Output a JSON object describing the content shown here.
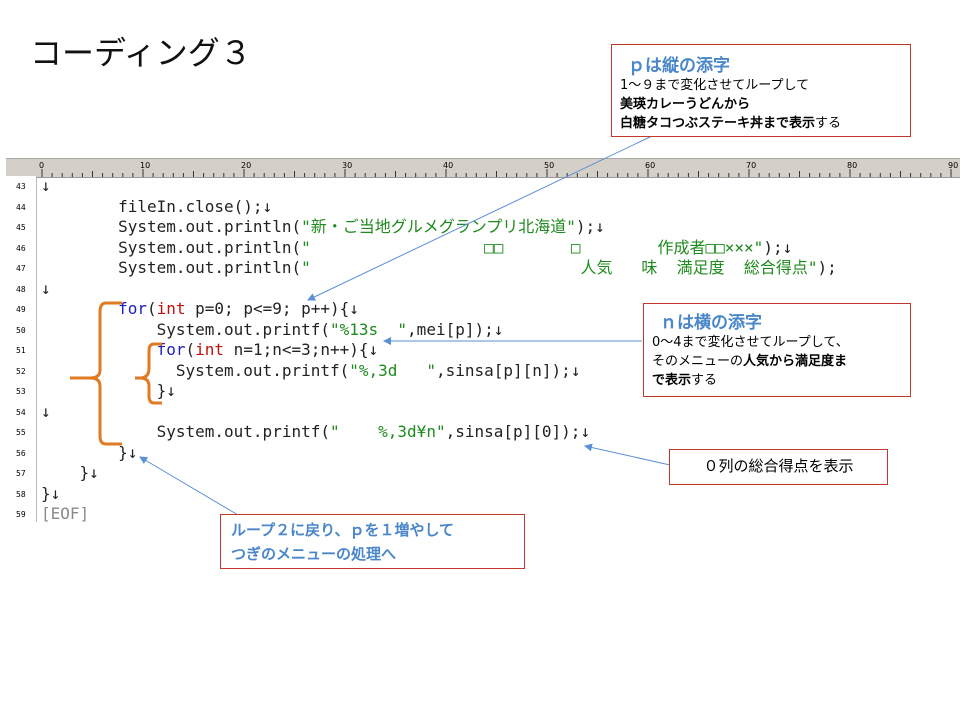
{
  "slide": {
    "title": "コーディング３"
  },
  "ruler": {
    "labels": [
      "0",
      "10",
      "20",
      "30",
      "40",
      "50",
      "60",
      "70",
      "80",
      "90"
    ]
  },
  "lines": [
    {
      "no": "43",
      "text": "↓"
    },
    {
      "no": "44",
      "text": "        fileIn.close();↓"
    },
    {
      "no": "45",
      "pre": "        System.out.println(",
      "str": "\"新・ご当地グルメグランプリ北海道\"",
      "post": ");↓"
    },
    {
      "no": "46",
      "pre": "        System.out.println(",
      "str": "\"                  □□       □        作成者□□×××\"",
      "post": ");↓"
    },
    {
      "no": "47",
      "pre": "        System.out.println(",
      "str": "\"                            人気   味  満足度  総合得点\"",
      "post": ");"
    },
    {
      "no": "48",
      "text": "↓"
    },
    {
      "no": "49",
      "pre": "        ",
      "kw": "for",
      "mid": "(",
      "kw2": "int",
      "post": " p=0; p<=9; p++){↓"
    },
    {
      "no": "50",
      "pre": "            System.out.printf(",
      "str": "\"%13s  \"",
      "post": ",mei[p]);↓"
    },
    {
      "no": "51",
      "pre": "            ",
      "kw": "for",
      "mid": "(",
      "kw2": "int",
      "post": " n=1;n<=3;n++){↓"
    },
    {
      "no": "52",
      "pre": "              System.out.printf(",
      "str": "\"%,3d   \"",
      "post": ",sinsa[p][n]);↓"
    },
    {
      "no": "53",
      "text": "            }↓"
    },
    {
      "no": "54",
      "text": "↓"
    },
    {
      "no": "55",
      "pre": "            System.out.printf(",
      "str": "\"    %,3d¥n\"",
      "post": ",sinsa[p][0]);↓"
    },
    {
      "no": "56",
      "text": "        }↓"
    },
    {
      "no": "57",
      "text": "    }↓"
    },
    {
      "no": "58",
      "text": "}↓"
    },
    {
      "no": "59",
      "text": "[EOF]"
    }
  ],
  "callouts": {
    "p": {
      "title": "ｐは縦の添字",
      "line1": "1～９まで変化させてループして",
      "line2": "美瑛カレーうどんから",
      "line3_bold": "白糖タコつぶステーキ丼まで表示",
      "line3_tail": "する"
    },
    "n": {
      "title": "ｎは横の添字",
      "line1": "0～4まで変化させてループして、",
      "line2_pre": "そのメニューの",
      "line2_bold": "人気から満足度ま",
      "line3_bold": "で表示",
      "line3_tail": "する"
    },
    "total": {
      "text": "０列の総合得点を表示"
    },
    "loop": {
      "line1": "ループ２に戻り、ｐを１増やして",
      "line2": "つぎのメニューの処理へ"
    }
  },
  "colors": {
    "bracket": "#e07b24",
    "arrow": "#5b8fd6",
    "callout_border": "#c0392b",
    "title_blue": "#4a86c8"
  }
}
